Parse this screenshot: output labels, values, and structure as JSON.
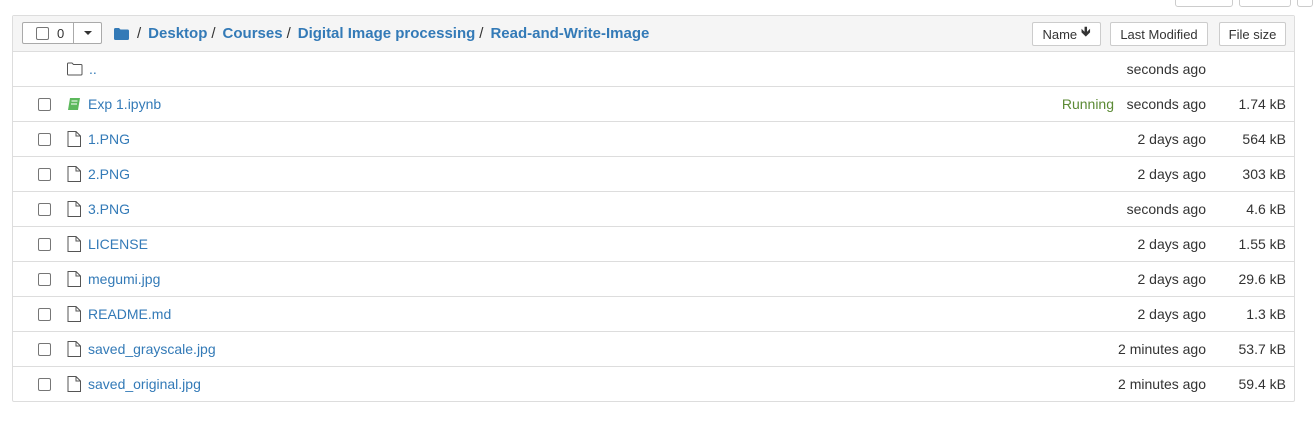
{
  "header": {
    "selected_count": "0",
    "breadcrumb": [
      "Desktop",
      "Courses",
      "Digital Image processing",
      "Read-and-Write-Image"
    ],
    "breadcrumb_sep": "/",
    "sort_name_label": "Name",
    "sort_modified_label": "Last Modified",
    "sort_size_label": "File size"
  },
  "parent_row": {
    "name": "..",
    "modified": "seconds ago"
  },
  "files": [
    {
      "name": "Exp 1.ipynb",
      "type": "notebook",
      "status": "Running",
      "modified": "seconds ago",
      "size": "1.74 kB"
    },
    {
      "name": "1.PNG",
      "type": "file",
      "status": "",
      "modified": "2 days ago",
      "size": "564 kB"
    },
    {
      "name": "2.PNG",
      "type": "file",
      "status": "",
      "modified": "2 days ago",
      "size": "303 kB"
    },
    {
      "name": "3.PNG",
      "type": "file",
      "status": "",
      "modified": "seconds ago",
      "size": "4.6 kB"
    },
    {
      "name": "LICENSE",
      "type": "file",
      "status": "",
      "modified": "2 days ago",
      "size": "1.55 kB"
    },
    {
      "name": "megumi.jpg",
      "type": "file",
      "status": "",
      "modified": "2 days ago",
      "size": "29.6 kB"
    },
    {
      "name": "README.md",
      "type": "file",
      "status": "",
      "modified": "2 days ago",
      "size": "1.3 kB"
    },
    {
      "name": "saved_grayscale.jpg",
      "type": "file",
      "status": "",
      "modified": "2 minutes ago",
      "size": "53.7 kB"
    },
    {
      "name": "saved_original.jpg",
      "type": "file",
      "status": "",
      "modified": "2 minutes ago",
      "size": "59.4 kB"
    }
  ],
  "colors": {
    "link": "#337ab7",
    "running": "#5c8a35",
    "notebook_icon": "#5cb85c"
  }
}
